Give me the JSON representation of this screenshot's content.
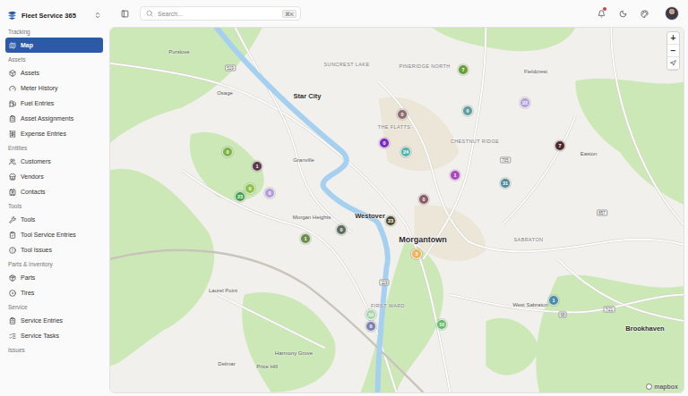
{
  "app": {
    "title": "Fleet Service 365"
  },
  "sidebar": {
    "sections": [
      {
        "label": "Tracking",
        "items": [
          {
            "label": "Map",
            "selected": true
          }
        ]
      },
      {
        "label": "Assets",
        "items": [
          {
            "label": "Assets",
            "selected": false
          },
          {
            "label": "Meter History",
            "selected": false
          },
          {
            "label": "Fuel Entries",
            "selected": false
          },
          {
            "label": "Asset Assignments",
            "selected": false
          },
          {
            "label": "Expense Entries",
            "selected": false
          }
        ]
      },
      {
        "label": "Entities",
        "items": [
          {
            "label": "Customers",
            "selected": false
          },
          {
            "label": "Vendors",
            "selected": false
          },
          {
            "label": "Contacts",
            "selected": false
          }
        ]
      },
      {
        "label": "Tools",
        "items": [
          {
            "label": "Tools",
            "selected": false
          },
          {
            "label": "Tool Service Entries",
            "selected": false
          },
          {
            "label": "Tool Issues",
            "selected": false
          }
        ]
      },
      {
        "label": "Parts & Inventory",
        "items": [
          {
            "label": "Parts",
            "selected": false
          },
          {
            "label": "Tires",
            "selected": false
          }
        ]
      },
      {
        "label": "Service",
        "items": [
          {
            "label": "Service Entries",
            "selected": false
          },
          {
            "label": "Service Tasks",
            "selected": false
          }
        ]
      },
      {
        "label": "Issues",
        "items": []
      }
    ]
  },
  "search": {
    "placeholder": "Search...",
    "shortcut": "⌘K"
  },
  "topbar": {
    "notifications_unread": true
  },
  "map": {
    "labels": [
      {
        "text": "Purslove",
        "kind": "place"
      },
      {
        "text": "Osage",
        "kind": "place"
      },
      {
        "text": "SUNCREST LAKE",
        "kind": "district"
      },
      {
        "text": "PINERIDGE NORTH",
        "kind": "district"
      },
      {
        "text": "Star City",
        "kind": "town"
      },
      {
        "text": "THE FLATTS",
        "kind": "district"
      },
      {
        "text": "CHESTNUT RIDGE",
        "kind": "district"
      },
      {
        "text": "Fieldcrest",
        "kind": "place"
      },
      {
        "text": "Easton",
        "kind": "place"
      },
      {
        "text": "Granville",
        "kind": "place"
      },
      {
        "text": "Morgan Heights",
        "kind": "place"
      },
      {
        "text": "Westover",
        "kind": "town"
      },
      {
        "text": "Morgantown",
        "kind": "city"
      },
      {
        "text": "SABRATON",
        "kind": "district"
      },
      {
        "text": "Laurel Point",
        "kind": "place"
      },
      {
        "text": "FIRST WARD",
        "kind": "district"
      },
      {
        "text": "West Sabraton",
        "kind": "place"
      },
      {
        "text": "Brookhaven",
        "kind": "town"
      },
      {
        "text": "Harmony Grove",
        "kind": "place"
      },
      {
        "text": "Delmar",
        "kind": "place"
      },
      {
        "text": "Price Hill",
        "kind": "place"
      }
    ],
    "shields": [
      "519",
      "705",
      "119",
      "68",
      "857",
      "7/21"
    ],
    "clusters": [
      {
        "count": "0",
        "color": "#7cb342"
      },
      {
        "count": "1",
        "color": "#5a3a4a"
      },
      {
        "count": "0",
        "color": "#8bc34a"
      },
      {
        "count": "23",
        "color": "#43a047"
      },
      {
        "count": "0",
        "color": "#b39ddb"
      },
      {
        "count": "1",
        "color": "#6b8e4e"
      },
      {
        "count": "0",
        "color": "#5d6b5d"
      },
      {
        "count": "23",
        "color": "#4a4a2a"
      },
      {
        "count": "0",
        "color": "#7b2cbf"
      },
      {
        "count": "0",
        "color": "#8d6e6e"
      },
      {
        "count": "24",
        "color": "#4db6ac"
      },
      {
        "count": "7",
        "color": "#689f38"
      },
      {
        "count": "0",
        "color": "#5f9ea0"
      },
      {
        "count": "22",
        "color": "#b39ddb"
      },
      {
        "count": "7",
        "color": "#4e2a2a"
      },
      {
        "count": "1",
        "color": "#ab47bc"
      },
      {
        "count": "31",
        "color": "#4f8a9a"
      },
      {
        "count": "0",
        "color": "#8d5a6a"
      },
      {
        "count": "3",
        "color": "#f0b25a"
      },
      {
        "count": "10",
        "color": "#a5d6a7"
      },
      {
        "count": "0",
        "color": "#8080b0"
      },
      {
        "count": "10",
        "color": "#66bb6a"
      },
      {
        "count": "1",
        "color": "#4a8aaa"
      }
    ],
    "controls": [
      "+",
      "−"
    ],
    "attribution": "mapbox"
  }
}
